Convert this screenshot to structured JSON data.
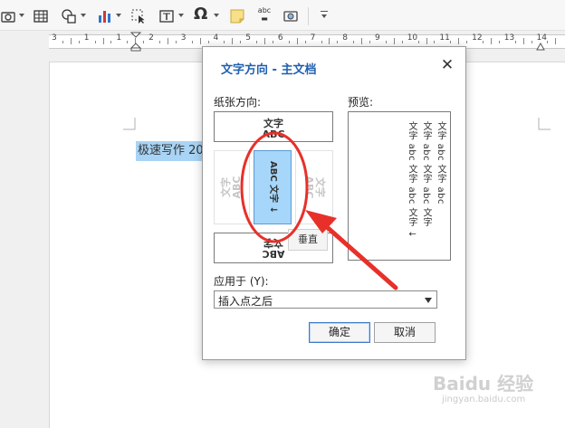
{
  "toolbar": {
    "icons": [
      "camera-icon",
      "table-icon",
      "shapes-icon",
      "chart-icon",
      "select-object-icon",
      "textbox-icon",
      "symbol-icon",
      "note-icon",
      "text-direction-icon",
      "screenshot-icon",
      "more-icon"
    ],
    "symbol_label": "Ω",
    "textdir_label": "abc"
  },
  "ruler": {
    "labels": [
      "3",
      "1",
      "1",
      "2",
      "3",
      "4",
      "5",
      "6",
      "7",
      "8",
      "9",
      "10",
      "11",
      "12",
      "13",
      "14",
      "15"
    ]
  },
  "document": {
    "selected_text": "极速写作 20"
  },
  "dialog": {
    "title": "文字方向 - 主文档",
    "close": "✕",
    "paper_orientation_label": "纸张方向:",
    "preview_label": "预览:",
    "sample_line1": "文字",
    "sample_line2": "ABC",
    "sample_vertical": "ABC 文字",
    "sample_vertical_arrow": "↓",
    "tooltip": "垂直",
    "preview_columns": [
      "文字 abc 文字 abc",
      "文字 abc 文字 abc 文字",
      "文字 abc 文字 abc 文字 ↓"
    ],
    "apply_to_label": "应用于 (Y):",
    "apply_to_value": "插入点之后",
    "ok": "确定",
    "cancel": "取消"
  },
  "watermark": {
    "brand": "Baidu 经验",
    "sub": "jingyan.baidu.com"
  },
  "colors": {
    "accent": "#2060b0",
    "selection": "#a6d6fa",
    "annotation": "#e8302a"
  }
}
